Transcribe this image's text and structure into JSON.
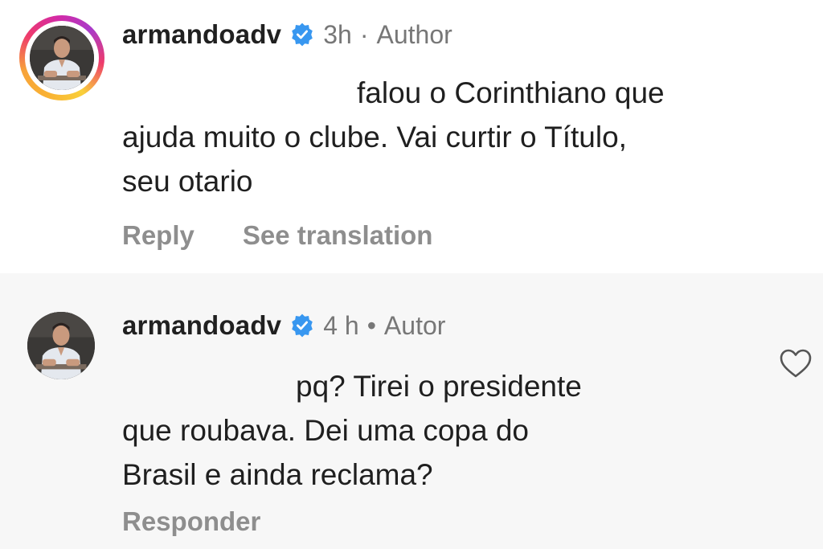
{
  "comments": [
    {
      "username": "armandoadv",
      "verified": true,
      "time": "3h",
      "separator": "·",
      "role": "Author",
      "text_lines": [
        "falou o Corinthiano que",
        "ajuda muito o clube. Vai curtir o Título,",
        "seu otario"
      ],
      "actions": [
        "Reply",
        "See translation"
      ],
      "avatar_ring": true,
      "avatar_icon": "profile-photo"
    },
    {
      "username": "armandoadv",
      "verified": true,
      "time": "4 h",
      "separator": "•",
      "role": "Autor",
      "text_lines": [
        "pq? Tirei o presidente",
        "que roubava. Dei uma copa do",
        "Brasil e ainda reclama?"
      ],
      "actions": [
        "Responder"
      ],
      "avatar_ring": false,
      "avatar_icon": "profile-photo",
      "like_icon": "heart-outline-icon"
    }
  ],
  "colors": {
    "verified_badge": "#3897f0",
    "username": "#202020",
    "meta": "#777777",
    "action": "#8e8e8e",
    "second_background": "#f7f7f7"
  }
}
